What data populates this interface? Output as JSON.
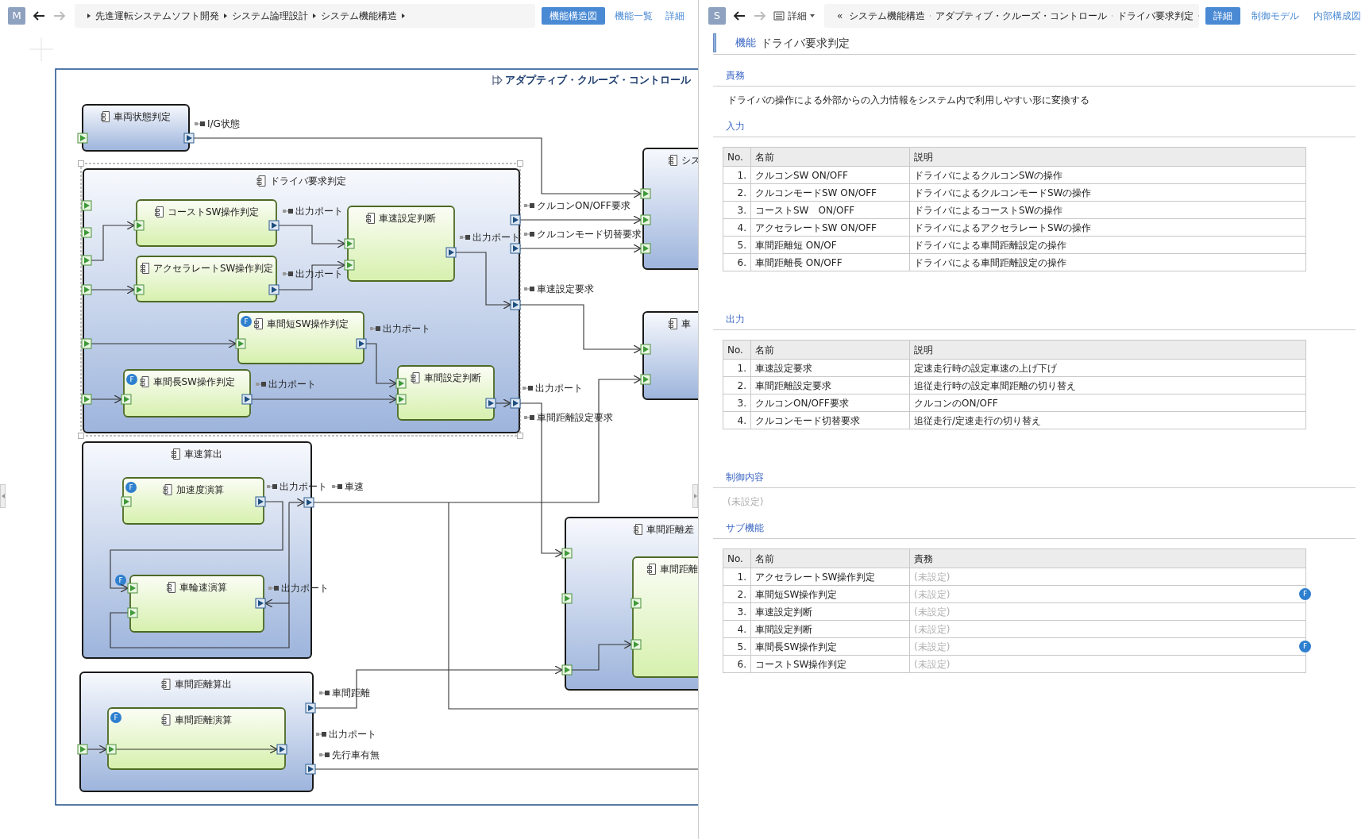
{
  "left_pane": {
    "avatar": "M",
    "back_enabled": true,
    "forward_enabled": false,
    "breadcrumb": [
      "先進運転システムソフト開発",
      "システム論理設計",
      "システム機能構造"
    ],
    "tabs": [
      {
        "label": "機能構造図",
        "selected": true
      },
      {
        "label": "機能一覧",
        "selected": false
      },
      {
        "label": "詳細",
        "selected": false
      }
    ]
  },
  "diagram": {
    "title": "アダプティブ・クルーズ・コントロール",
    "nodes": [
      {
        "label": "車両状態判定",
        "kind": "container",
        "selected": false
      },
      {
        "label": "ドライバ要求判定",
        "kind": "container",
        "selected": true
      },
      {
        "label": "コーストSW操作判定",
        "kind": "function",
        "selected": false
      },
      {
        "label": "アクセラレートSW操作判定",
        "kind": "function",
        "selected": false
      },
      {
        "label": "車速設定判断",
        "kind": "function",
        "selected": false
      },
      {
        "label": "車間短SW操作判定",
        "kind": "function",
        "selected": false,
        "badges": [
          "F"
        ]
      },
      {
        "label": "車間長SW操作判定",
        "kind": "function",
        "selected": false,
        "badges": [
          "F"
        ]
      },
      {
        "label": "車間設定判断",
        "kind": "function",
        "selected": false
      },
      {
        "label": "シス",
        "kind": "container",
        "selected": false
      },
      {
        "label": "車",
        "kind": "container",
        "selected": false
      },
      {
        "label": "車速算出",
        "kind": "container",
        "selected": false
      },
      {
        "label": "加速度演算",
        "kind": "function",
        "selected": false,
        "badges": [
          "F"
        ]
      },
      {
        "label": "車輪速演算",
        "kind": "function",
        "selected": false,
        "badges": [
          "F"
        ]
      },
      {
        "label": "車間距離算出",
        "kind": "container",
        "selected": false
      },
      {
        "label": "車間距離演算",
        "kind": "function",
        "selected": false,
        "badges": [
          "F"
        ]
      },
      {
        "label": "車間距離差",
        "kind": "container",
        "selected": false
      },
      {
        "label": "車間距離",
        "kind": "function",
        "selected": false
      }
    ],
    "port_labels": [
      "I/G状態",
      "出力ポート",
      "出力ポート",
      "出力ポート",
      "クルコンON/OFF要求",
      "クルコンモード切替要求",
      "車速設定要求",
      "出力ポート",
      "出力ポート",
      "出力ポート",
      "車間距離設定要求",
      "出力ポート",
      "車速",
      "出力ポート",
      "車間距離",
      "出力ポート",
      "先行車有無"
    ]
  },
  "right_pane": {
    "avatar": "S",
    "back_enabled": true,
    "forward_enabled": false,
    "view_menu": "詳細",
    "breadcrumb_overflow": "«",
    "breadcrumb": [
      "システム機能構造",
      "アダプティブ・クルーズ・コントロール",
      "ドライバ要求判定"
    ],
    "tabs": [
      {
        "label": "詳細",
        "selected": true
      },
      {
        "label": "制御モデル",
        "selected": false
      },
      {
        "label": "内部構成図",
        "selected": false
      }
    ],
    "kind_label": "機能",
    "title": "ドライバ要求判定",
    "sections": [
      {
        "heading": "責務",
        "kind": "text",
        "text": "ドライバの操作による外部からの入力情報をシステム内で利用しやすい形に変換する",
        "unset": false
      },
      {
        "heading": "入力",
        "kind": "table",
        "columns": [
          "No.",
          "名前",
          "説明"
        ],
        "rows": [
          {
            "cells": [
              "1.",
              "クルコンSW ON/OFF",
              "ドライバによるクルコンSWの操作"
            ],
            "unset": false
          },
          {
            "cells": [
              "2.",
              "クルコンモードSW ON/OFF",
              "ドライバによるクルコンモードSWの操作"
            ],
            "unset": false
          },
          {
            "cells": [
              "3.",
              "コーストSW　ON/OFF",
              "ドライバによるコーストSWの操作"
            ],
            "unset": false
          },
          {
            "cells": [
              "4.",
              "アクセラレートSW ON/OFF",
              "ドライバによるアクセラレートSWの操作"
            ],
            "unset": false
          },
          {
            "cells": [
              "5.",
              "車間距離短 ON/OF",
              "ドライバによる車間距離設定の操作"
            ],
            "unset": false
          },
          {
            "cells": [
              "6.",
              "車間距離長 ON/OFF",
              "ドライバによる車間距離設定の操作"
            ],
            "unset": false
          }
        ]
      },
      {
        "heading": "出力",
        "kind": "table",
        "columns": [
          "No.",
          "名前",
          "説明"
        ],
        "rows": [
          {
            "cells": [
              "1.",
              "車速設定要求",
              "定速走行時の設定車速の上げ下げ"
            ],
            "unset": false
          },
          {
            "cells": [
              "2.",
              "車間距離設定要求",
              "追従走行時の設定車間距離の切り替え"
            ],
            "unset": false
          },
          {
            "cells": [
              "3.",
              "クルコンON/OFF要求",
              "クルコンのON/OFF"
            ],
            "unset": false
          },
          {
            "cells": [
              "4.",
              "クルコンモード切替要求",
              "追従走行/定速走行の切り替え"
            ],
            "unset": false
          }
        ]
      },
      {
        "heading": "制御内容",
        "kind": "text",
        "text": "(未設定)",
        "unset": true
      },
      {
        "heading": "サブ機能",
        "kind": "table",
        "columns": [
          "No.",
          "名前",
          "責務"
        ],
        "rows": [
          {
            "cells": [
              "1.",
              "アクセラレートSW操作判定",
              "(未設定)"
            ],
            "unset": true
          },
          {
            "cells": [
              "2.",
              "車間短SW操作判定",
              "(未設定)"
            ],
            "unset": true,
            "badge": "F"
          },
          {
            "cells": [
              "3.",
              "車速設定判断",
              "(未設定)"
            ],
            "unset": true
          },
          {
            "cells": [
              "4.",
              "車間設定判断",
              "(未設定)"
            ],
            "unset": true
          },
          {
            "cells": [
              "5.",
              "車間長SW操作判定",
              "(未設定)"
            ],
            "unset": true,
            "badge": "F"
          },
          {
            "cells": [
              "6.",
              "コーストSW操作判定",
              "(未設定)"
            ],
            "unset": true
          }
        ]
      }
    ]
  }
}
